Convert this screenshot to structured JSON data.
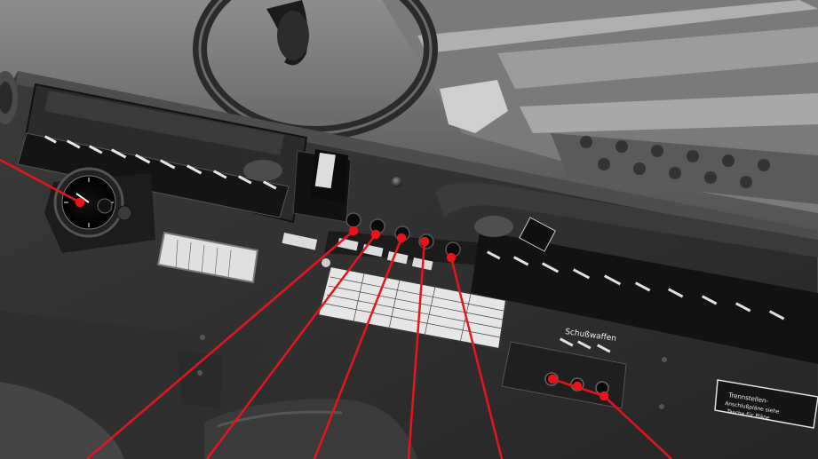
{
  "cockpit": {
    "side_labels": [
      "",
      "",
      "",
      "",
      "",
      "",
      "",
      "",
      "",
      "",
      "",
      ""
    ],
    "fuse_box_text": "",
    "plate_text": "",
    "left_placard_text": "",
    "right_labels": [
      "",
      "",
      "",
      "",
      "",
      "",
      "",
      "",
      "",
      "",
      "",
      "",
      ""
    ],
    "sliding_panel_title": "Schußwaffen",
    "sliding_panel_labels": [
      "",
      "",
      ""
    ],
    "upper_right_badge": "",
    "bottom_right_placard": "Trennstellen-\nAnschlußpläne siehe\nTasche für Pläne"
  },
  "colors": {
    "callout": "#e8141b",
    "panel": "#2f2f2f",
    "panel_dark": "#1f1f1f",
    "label_strip": "#141414"
  }
}
